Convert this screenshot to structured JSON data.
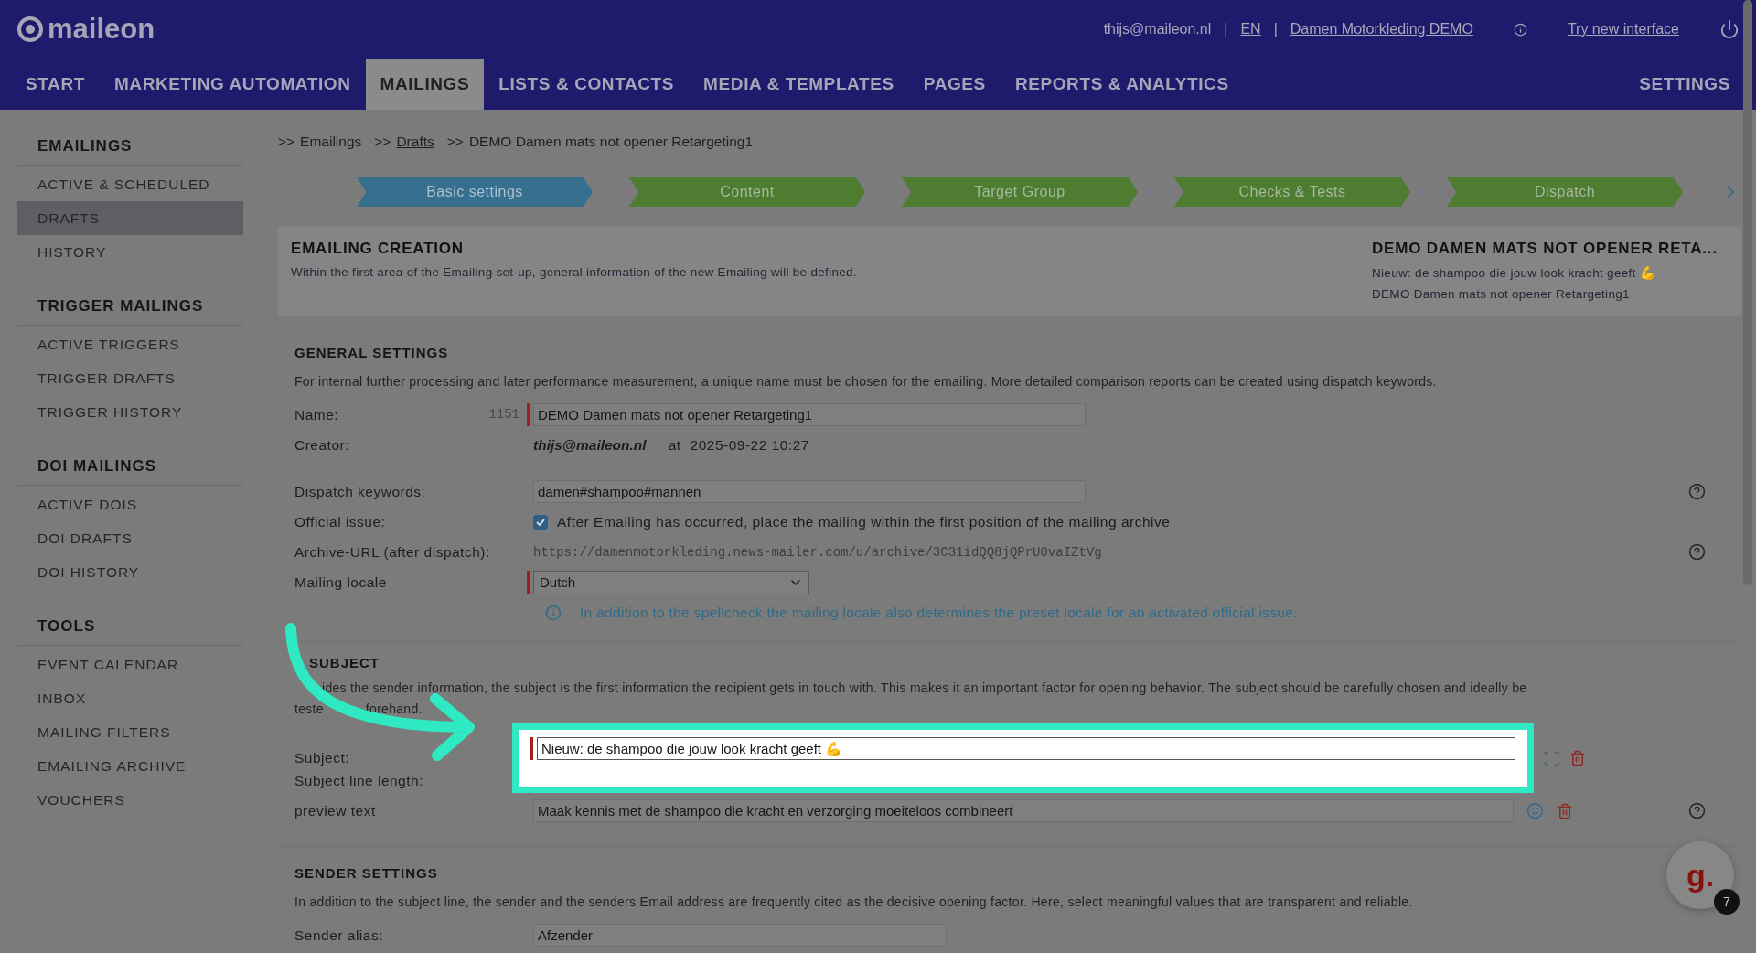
{
  "header": {
    "logo": "maileon",
    "user": "thijs@maileon.nl",
    "separator_1": "|",
    "language": "EN",
    "separator_2": "|",
    "account": "Damen Motorkleding DEMO",
    "try_new": "Try new interface"
  },
  "nav": {
    "items": [
      {
        "label": "START",
        "selected": false
      },
      {
        "label": "MARKETING AUTOMATION",
        "selected": false
      },
      {
        "label": "MAILINGS",
        "selected": true
      },
      {
        "label": "LISTS & CONTACTS",
        "selected": false
      },
      {
        "label": "MEDIA & TEMPLATES",
        "selected": false
      },
      {
        "label": "PAGES",
        "selected": false
      },
      {
        "label": "REPORTS & ANALYTICS",
        "selected": false
      }
    ],
    "settings": "SETTINGS"
  },
  "sidebar": {
    "sections": [
      {
        "title": "EMAILINGS",
        "items": [
          {
            "label": "ACTIVE & SCHEDULED",
            "selected": false
          },
          {
            "label": "DRAFTS",
            "selected": true
          },
          {
            "label": "HISTORY",
            "selected": false
          }
        ]
      },
      {
        "title": "TRIGGER MAILINGS",
        "items": [
          {
            "label": "ACTIVE TRIGGERS",
            "selected": false
          },
          {
            "label": "TRIGGER DRAFTS",
            "selected": false
          },
          {
            "label": "TRIGGER HISTORY",
            "selected": false
          }
        ]
      },
      {
        "title": "DOI MAILINGS",
        "items": [
          {
            "label": "ACTIVE DOIS",
            "selected": false
          },
          {
            "label": "DOI DRAFTS",
            "selected": false
          },
          {
            "label": "DOI HISTORY",
            "selected": false
          }
        ]
      },
      {
        "title": "TOOLS",
        "items": [
          {
            "label": "EVENT CALENDAR",
            "selected": false
          },
          {
            "label": "INBOX",
            "selected": false
          },
          {
            "label": "MAILING FILTERS",
            "selected": false
          },
          {
            "label": "EMAILING ARCHIVE",
            "selected": false
          },
          {
            "label": "VOUCHERS",
            "selected": false
          }
        ]
      }
    ]
  },
  "breadcrumb": [
    {
      "prefix": ">>",
      "label": "Emailings",
      "link": false
    },
    {
      "prefix": ">>",
      "label": "Drafts",
      "link": true
    },
    {
      "prefix": ">>",
      "label": "DEMO Damen mats not opener Retargeting1",
      "link": false
    }
  ],
  "steps": [
    {
      "label": "Basic settings",
      "selected": true
    },
    {
      "label": "Content",
      "selected": false
    },
    {
      "label": "Target Group",
      "selected": false
    },
    {
      "label": "Checks & Tests",
      "selected": false
    },
    {
      "label": "Dispatch",
      "selected": false
    }
  ],
  "creation": {
    "title": "EMAILING CREATION",
    "description": "Within the first area of the Emailing set-up, general information of the new Emailing will be defined.",
    "summary_title": "DEMO DAMEN MATS NOT OPENER RETA...",
    "summary_subject": "Nieuw: de shampoo die jouw look kracht geeft 💪",
    "summary_name": "DEMO Damen mats not opener Retargeting1"
  },
  "general": {
    "title": "GENERAL SETTINGS",
    "description": "For internal further processing and later performance measurement, a unique name must be chosen for the emailing. More detailed comparison reports can be created using dispatch keywords.",
    "row_groups": [
      [
        {
          "kind": "input",
          "label": "Name:",
          "number": "1151",
          "value": "DEMO Damen mats not opener Retargeting1",
          "required": true,
          "help": false
        },
        {
          "kind": "creator",
          "label": "Creator:",
          "author": "thijs@maileon.nl",
          "at": "at",
          "date": "2025-09-22 10:27",
          "help": false
        }
      ],
      [
        {
          "kind": "input",
          "label": "Dispatch keywords:",
          "value": "damen#shampoo#mannen",
          "required": false,
          "help": true
        },
        {
          "kind": "checkbox",
          "label": "Official issue:",
          "checked": true,
          "text": "After Emailing has occurred, place the mailing within the first position of the mailing archive",
          "help": false
        },
        {
          "kind": "url",
          "label": "Archive-URL (after dispatch):",
          "value": "https://damenmotorkleding.news-mailer.com/u/archive/3C31idQQ8jQPrU0vaIZtVg",
          "help": true
        },
        {
          "kind": "select",
          "label": "Mailing locale",
          "value": "Dutch",
          "required": true,
          "help": false
        }
      ]
    ],
    "note": "In addition to the spellcheck the mailing locale also determines the preset locale for an activated official issue."
  },
  "subject": {
    "title": "SUBJECT",
    "description_line1": "ides the sender information, the subject is the first information the recipient gets in touch with. This makes it an important factor for opening behavior. The subject should be carefully chosen and ideally be",
    "description_line2_start": "teste",
    "description_line2_end": "forehand.",
    "subject_label": "Subject:",
    "subject_value": "Nieuw: de shampoo die jouw look kracht geeft 💪",
    "length_label": "Subject line length:",
    "preview_label": "preview text",
    "preview_value": "Maak kennis met de shampoo die kracht en verzorging moeiteloos combineert"
  },
  "sender": {
    "title": "SENDER SETTINGS",
    "description": "In addition to the subject line, the sender and the senders Email address are frequently cited as the decisive opening factor. Here, select meaningful values that are transparent and reliable.",
    "alias_label": "Sender alias:",
    "alias_value": "Afzender"
  },
  "chat_widget": {
    "logo": "g.",
    "badge": "7"
  }
}
